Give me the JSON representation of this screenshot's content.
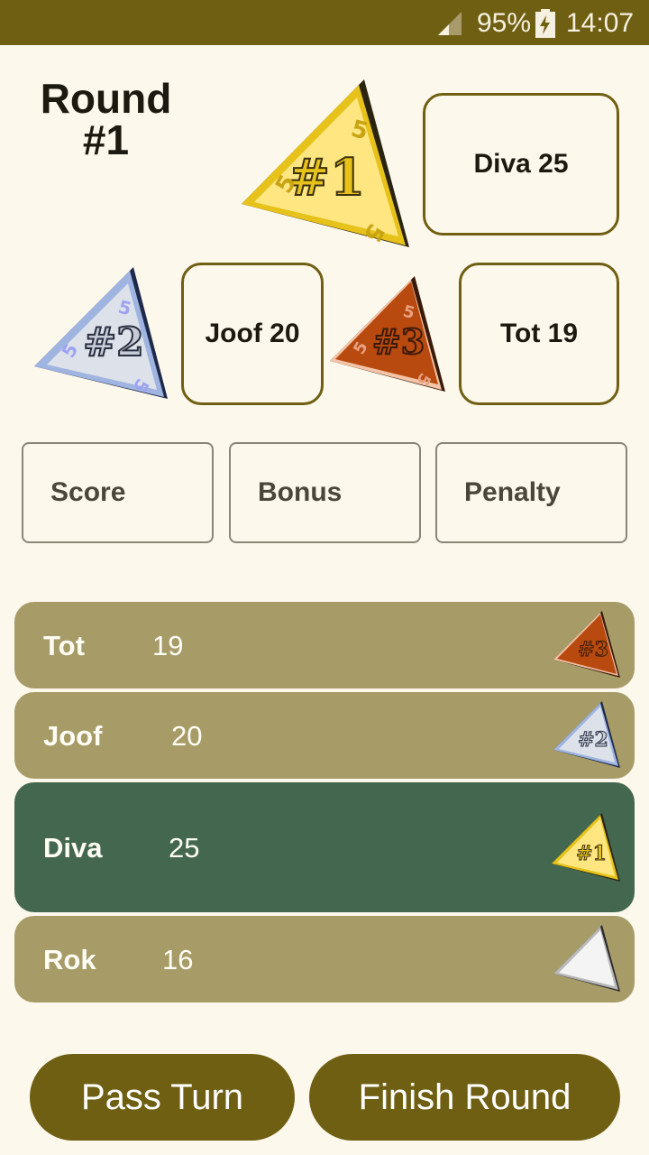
{
  "status_bar": {
    "battery": "95%",
    "time": "14:07"
  },
  "round": {
    "label": "Round",
    "number": "#1"
  },
  "podium": {
    "first": {
      "badge": "#1",
      "text": "Diva 25"
    },
    "second": {
      "badge": "#2",
      "text": "Joof 20"
    },
    "third": {
      "badge": "#3",
      "text": "Tot 19"
    }
  },
  "fields": {
    "score_placeholder": "Score",
    "bonus_placeholder": "Bonus",
    "penalty_placeholder": "Penalty"
  },
  "players": [
    {
      "name": "Tot",
      "score": "19",
      "badge": "#3"
    },
    {
      "name": "Joof",
      "score": "20",
      "badge": "#2"
    },
    {
      "name": "Diva",
      "score": "25",
      "badge": "#1"
    },
    {
      "name": "Rok",
      "score": "16",
      "badge": ""
    }
  ],
  "buttons": {
    "pass": "Pass Turn",
    "finish": "Finish Round"
  },
  "colors": {
    "accent": "#6f5f12",
    "row": "#a79c68",
    "active_row": "#43674f",
    "background": "#fdf8ec"
  }
}
